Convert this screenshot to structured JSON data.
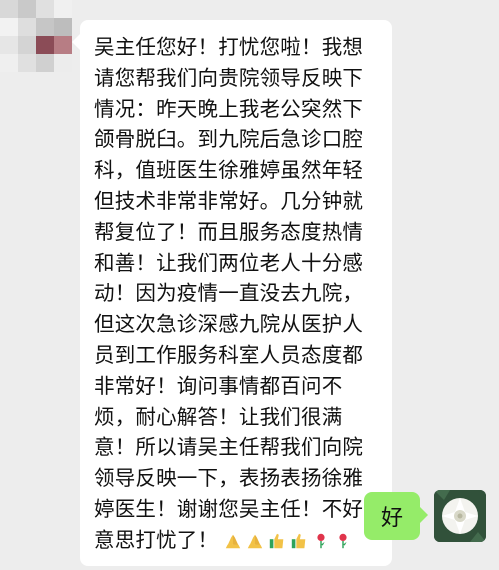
{
  "incoming_message": {
    "text": "吴主任您好！打忧您啦！我想请您帮我们向贵院领导反映下情况：昨天晚上我老公突然下颌骨脱臼。到九院后急诊口腔科，值班医生徐雅婷虽然年轻但技术非常非常好。几分钟就帮复位了！而且服务态度热情和善！让我们两位老人十分感动！因为疫情一直没去九院，但这次急诊深感九院从医护人员到工作服务科室人员态度都非常好！询问事情都百问不烦，耐心解答！让我们很满意！所以请吴主任帮我们向院领导反映一下，表扬表扬徐雅婷医生！谢谢您吴主任！不好意思打忧了！",
    "emojis": [
      "folded-hands-icon",
      "folded-hands-icon",
      "thumbs-up-icon",
      "thumbs-up-icon",
      "rose-icon",
      "rose-icon"
    ]
  },
  "outgoing_message": {
    "text": "好"
  },
  "colors": {
    "chat_background": "#ededed",
    "incoming_bubble": "#ffffff",
    "outgoing_bubble": "#95ec69"
  }
}
